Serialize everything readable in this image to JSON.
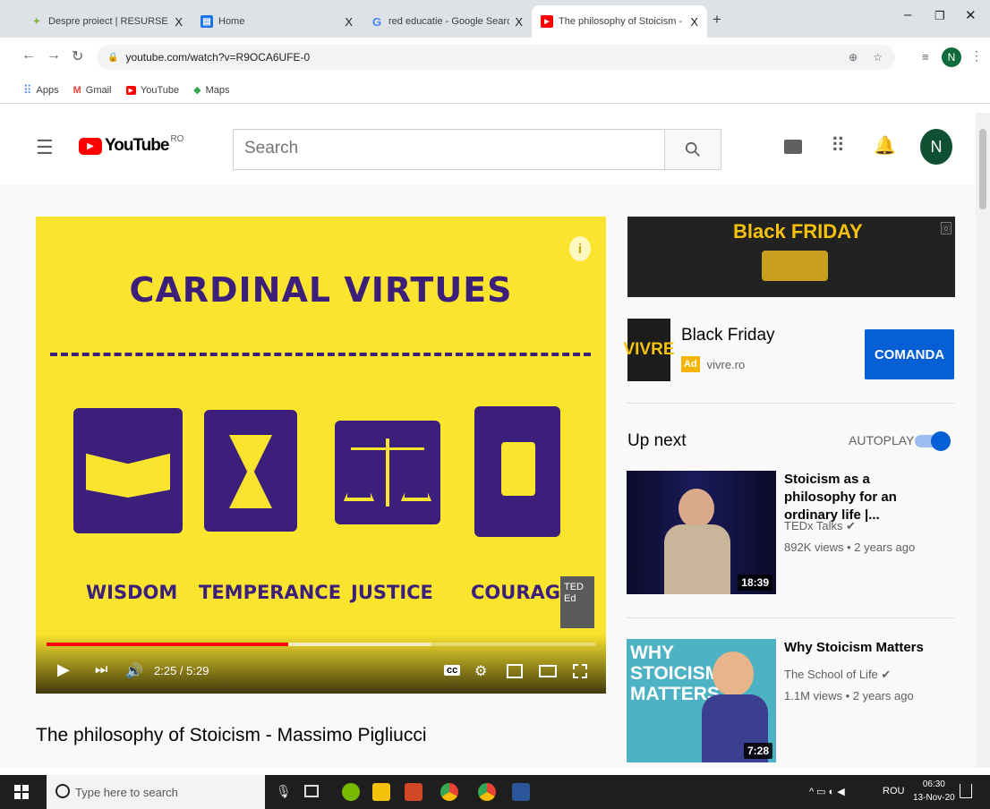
{
  "browser": {
    "tabs": [
      {
        "title": "Despre proiect | RESURSE EDUCA",
        "close": "X"
      },
      {
        "title": "Home",
        "close": "X"
      },
      {
        "title": "red educatie - Google Search",
        "close": "X"
      },
      {
        "title": "The philosophy of Stoicism - Ma",
        "close": "X"
      }
    ],
    "new_tab": "+",
    "url": "youtube.com/watch?v=R9OCA6UFE-0",
    "bookmarks": [
      "Apps",
      "Gmail",
      "YouTube",
      "Maps"
    ],
    "profile_initial": "N"
  },
  "youtube": {
    "logo_text": "YouTube",
    "region": "RO",
    "search_placeholder": "Search",
    "avatar_initial": "N"
  },
  "player": {
    "title_art": "CARDINAL VIRTUES",
    "virtues": [
      "WISDOM",
      "TEMPERANCE",
      "JUSTICE",
      "COURAGE"
    ],
    "time": "2:25 / 5:29",
    "progress": 0.44,
    "buffered": 0.7,
    "ted_badge": "TED Ed"
  },
  "video": {
    "title": "The philosophy of Stoicism - Massimo Pigliucci"
  },
  "ad": {
    "banner_text": "Black FRIDAY",
    "logo": "VIVRE",
    "title": "Black Friday",
    "badge": "Ad",
    "domain": "vivre.ro",
    "cta": "COMANDA"
  },
  "up_next": {
    "label": "Up next",
    "autoplay_label": "AUTOPLAY",
    "videos": [
      {
        "title": "Stoicism as a philosophy for an ordinary life |...",
        "channel": "TEDx Talks",
        "meta": "892K views • 2 years ago",
        "duration": "18:39"
      },
      {
        "title": "Why Stoicism Matters",
        "channel": "The School of Life",
        "meta": "1.1M views • 2 years ago",
        "duration": "7:28",
        "thumb_text": "WHY STOICISM MATTERS"
      }
    ]
  },
  "taskbar": {
    "search_placeholder": "Type here to search",
    "lang": "ROU",
    "time": "06:30",
    "date": "13-Nov-20"
  }
}
